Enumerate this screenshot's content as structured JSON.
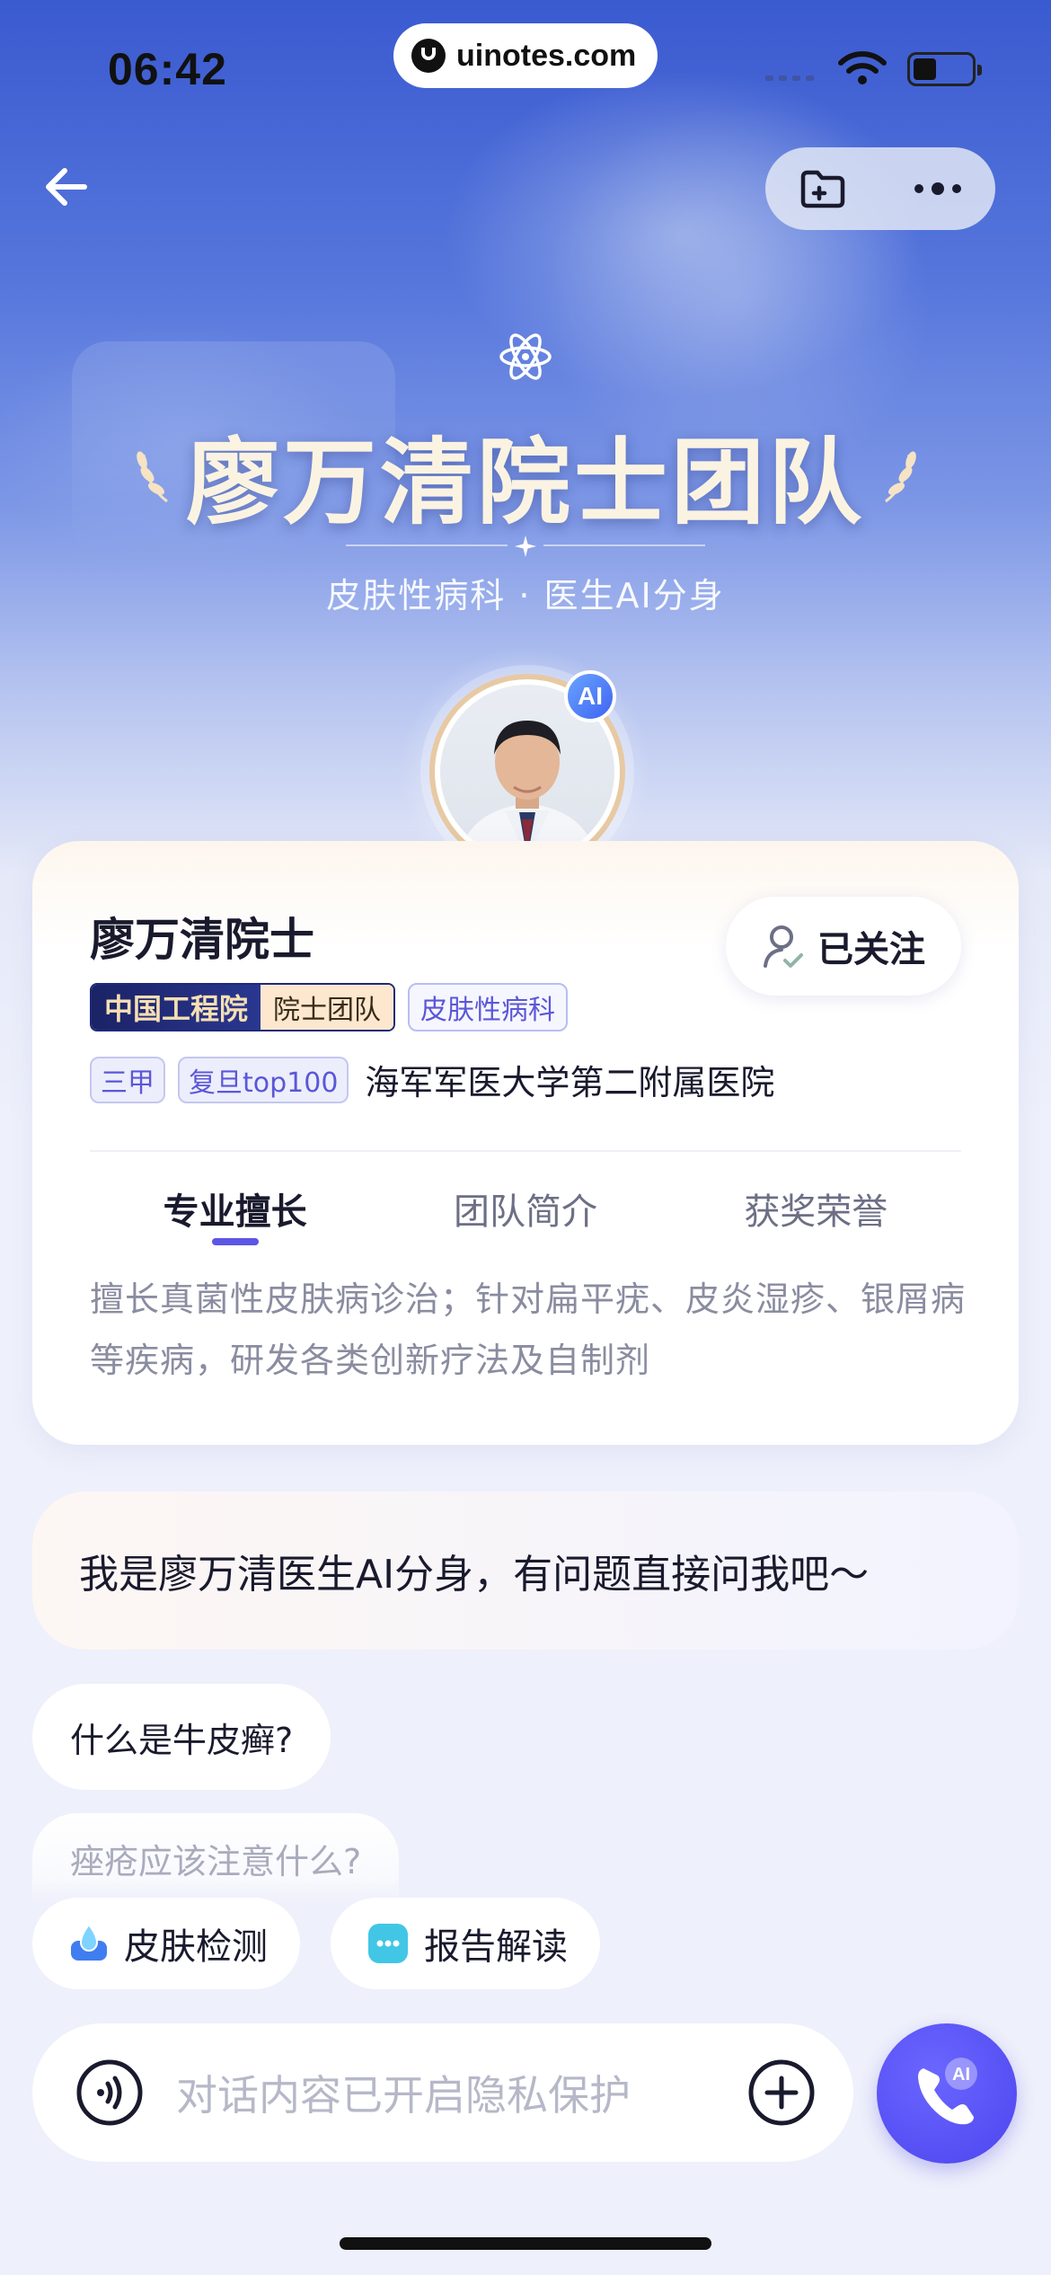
{
  "status_bar": {
    "time": "06:42",
    "url": "uinotes.com",
    "battery_level": 0.4
  },
  "hero": {
    "title": "廖万清院士团队",
    "subtitle": "皮肤性病科 · 医生AI分身",
    "ai_badge": "AI"
  },
  "profile": {
    "name": "廖万清院士",
    "follow_label": "已关注",
    "tags": {
      "academy": "中国工程院",
      "team": "院士团队",
      "department": "皮肤性病科"
    },
    "hospital_tags": [
      "三甲",
      "复旦top100"
    ],
    "hospital": "海军军医大学第二附属医院",
    "tabs": [
      {
        "label": "专业擅长",
        "active": true
      },
      {
        "label": "团队简介",
        "active": false
      },
      {
        "label": "获奖荣誉",
        "active": false
      }
    ],
    "description": "擅长真菌性皮肤病诊治；针对扁平疣、皮炎湿疹、银屑病等疾病，研发各类创新疗法及自制剂"
  },
  "chat": {
    "greeting": "我是廖万清医生AI分身，有问题直接问我吧～",
    "suggestions": [
      "什么是牛皮癣?",
      "痤疮应该注意什么?"
    ],
    "tools": [
      "皮肤检测",
      "报告解读"
    ],
    "input_placeholder": "对话内容已开启隐私保护",
    "call_badge": "AI"
  },
  "colors": {
    "accent": "#5d55e6",
    "hero_top": "#3a5ad0",
    "gold": "#e7c9a3",
    "navy_tag": "#1b2366"
  }
}
